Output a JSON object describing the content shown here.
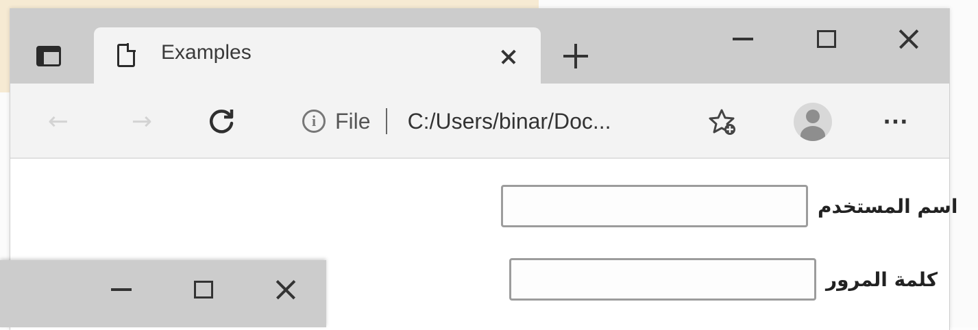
{
  "window": {
    "tab_title": "Examples",
    "controls": [
      "minimize",
      "maximize",
      "close"
    ]
  },
  "toolbar": {
    "back_icon": "←",
    "forward_icon": "→",
    "scheme_label": "File",
    "info_icon": "i",
    "url": "C:/Users/binar/Doc...",
    "more_label": "···"
  },
  "form": {
    "username_label": "اسم المستخدم",
    "password_label": "كلمة المرور",
    "username_value": "",
    "password_value": ""
  },
  "colors": {
    "tabstrip": "#cccccc",
    "toolbar": "#f3f3f3",
    "highlight": "#f6ead3"
  }
}
